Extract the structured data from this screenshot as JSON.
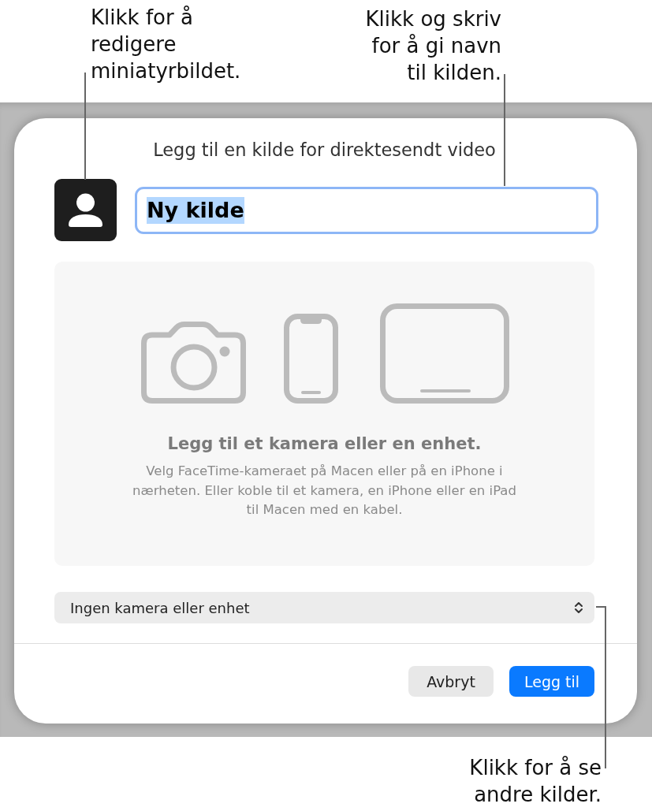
{
  "callouts": {
    "thumbnail": {
      "lines": [
        "Klikk for å",
        "redigere",
        "miniatyrbildet."
      ]
    },
    "name": {
      "lines": [
        "Klikk og skriv",
        "for å gi navn",
        "til kilden."
      ]
    },
    "source": {
      "lines": [
        "Klikk for å se",
        "andre kilder."
      ]
    }
  },
  "dialog": {
    "title": "Legg til en kilde for direktesendt video",
    "name_field": {
      "value": "Ny kilde",
      "focused": true,
      "text_selected": true
    },
    "device_panel": {
      "heading": "Legg til et kamera eller en enhet.",
      "description_lines": [
        "Velg FaceTime-kameraet på Macen eller på en iPhone i",
        "nærheten. Eller koble til et kamera, en iPhone eller en iPad",
        "til Macen med en kabel."
      ]
    },
    "source_popup": {
      "value": "Ingen kamera eller enhet"
    },
    "buttons": [
      {
        "label": "Avbryt",
        "kind": "secondary"
      },
      {
        "label": "Legg til",
        "kind": "primary"
      }
    ]
  }
}
